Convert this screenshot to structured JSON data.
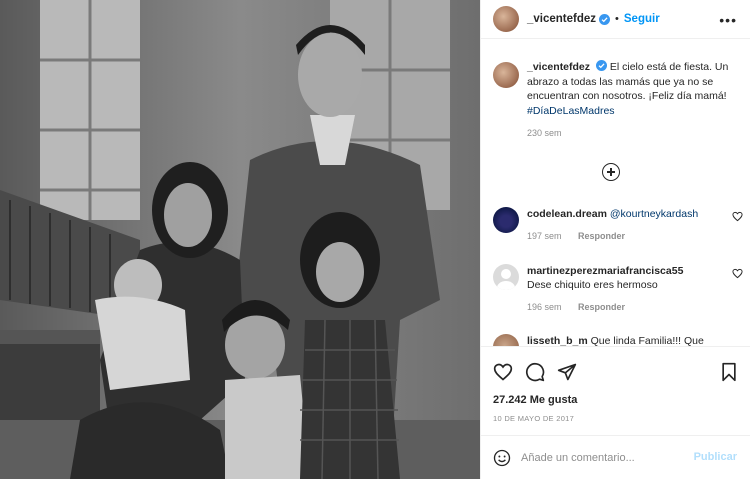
{
  "post": {
    "username": "_vicentefdez",
    "follow_label": "Seguir",
    "more_label": "•••",
    "caption_text": "El cielo está de fiesta. Un abrazo a todas las mamás que ya no se encuentran con nosotros. ¡Feliz día mamá!",
    "hashtag": "#DíaDeLasMadres",
    "caption_time": "230 sem",
    "likes": "27.242 Me gusta",
    "date": "10 DE MAYO DE 2017"
  },
  "comments": [
    {
      "username": "codelean.dream",
      "text": "",
      "mention": "@kourtneykardash",
      "time": "197 sem",
      "reply": "Responder"
    },
    {
      "username": "martinezperezmariafrancisca55",
      "text": "Dese chiquito eres hermoso",
      "mention": "",
      "time": "196 sem",
      "reply": "Responder"
    },
    {
      "username": "lisseth_b_m",
      "text": "Que linda Familia!!! Que",
      "mention": "",
      "time": "",
      "reply": ""
    }
  ],
  "composer": {
    "placeholder": "Añade un comentario...",
    "publish_label": "Publicar"
  },
  "colors": {
    "accent": "#0095f6",
    "link": "#00376b",
    "muted": "#8e8e8e",
    "publish_disabled": "#b2dffc"
  },
  "icons": [
    "verified-badge-icon",
    "more-options-icon",
    "load-more-comments-icon",
    "heart-icon",
    "comment-icon",
    "share-icon",
    "bookmark-icon",
    "emoji-icon"
  ]
}
